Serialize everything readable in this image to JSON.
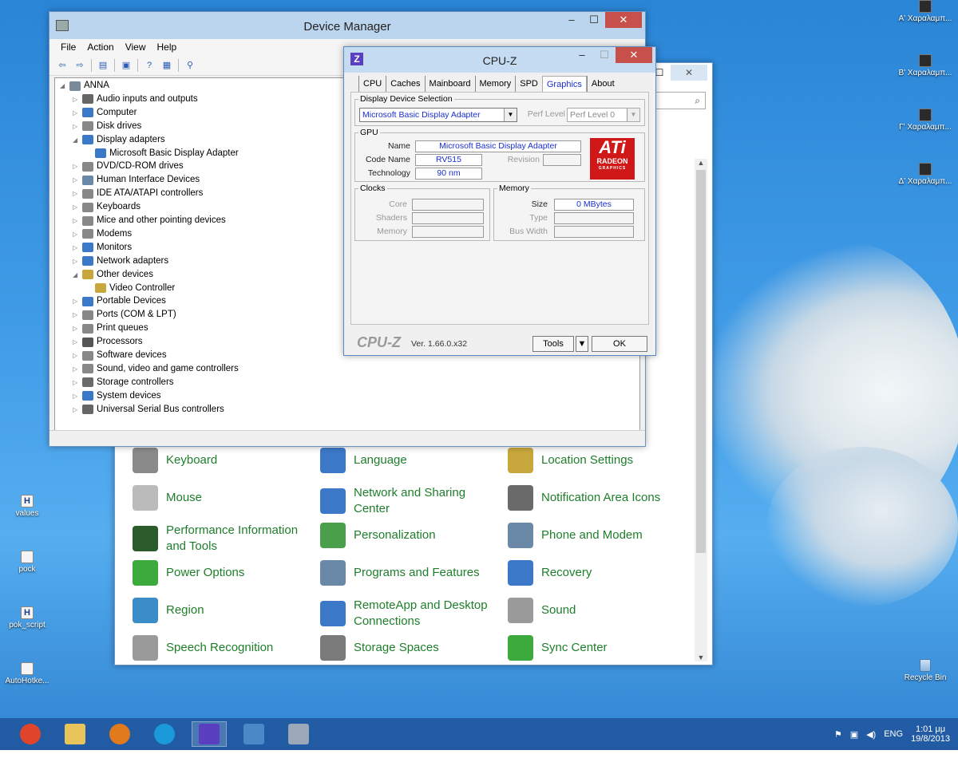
{
  "desktop": {
    "icons_right": [
      {
        "label": "Α' Χαραλαμπ..."
      },
      {
        "label": "Β' Χαραλαμπ..."
      },
      {
        "label": "Γ' Χαραλαμπ..."
      },
      {
        "label": "Δ' Χαραλαμπ..."
      }
    ],
    "icons_left": [
      {
        "label": "values"
      },
      {
        "label": "pock"
      },
      {
        "label": "pok_script"
      },
      {
        "label": "AutoHotke..."
      }
    ],
    "recycle_bin": "Recycle Bin"
  },
  "control_panel": {
    "search_glyph": "⌕",
    "items": [
      {
        "label": "Keyboard",
        "color": "#8a8a8a"
      },
      {
        "label": "Language",
        "color": "#3c78c8"
      },
      {
        "label": "Location Settings",
        "color": "#c8a83c"
      },
      {
        "label": "Mouse",
        "color": "#bbbbbb"
      },
      {
        "label": "Network and Sharing Center",
        "color": "#3c78c8"
      },
      {
        "label": "Notification Area Icons",
        "color": "#6a6a6a"
      },
      {
        "label": "Performance Information and Tools",
        "color": "#2b5a2b"
      },
      {
        "label": "Personalization",
        "color": "#4aa04a"
      },
      {
        "label": "Phone and Modem",
        "color": "#6a88a8"
      },
      {
        "label": "Power Options",
        "color": "#3caa3c"
      },
      {
        "label": "Programs and Features",
        "color": "#6a88a8"
      },
      {
        "label": "Recovery",
        "color": "#3c78c8"
      },
      {
        "label": "Region",
        "color": "#3c8cc8"
      },
      {
        "label": "RemoteApp and Desktop Connections",
        "color": "#3c78c8"
      },
      {
        "label": "Sound",
        "color": "#9a9a9a"
      },
      {
        "label": "Speech Recognition",
        "color": "#9a9a9a"
      },
      {
        "label": "Storage Spaces",
        "color": "#7a7a7a"
      },
      {
        "label": "Sync Center",
        "color": "#3caa3c"
      }
    ]
  },
  "device_manager": {
    "title": "Device Manager",
    "menu": [
      "File",
      "Action",
      "View",
      "Help"
    ],
    "tree": [
      {
        "label": "ANNA",
        "level": 0,
        "arrow": "◢",
        "color": "#7a8a9a"
      },
      {
        "label": "Audio inputs and outputs",
        "level": 1,
        "arrow": "▷",
        "color": "#666666"
      },
      {
        "label": "Computer",
        "level": 1,
        "arrow": "▷",
        "color": "#3c78c8"
      },
      {
        "label": "Disk drives",
        "level": 1,
        "arrow": "▷",
        "color": "#888888"
      },
      {
        "label": "Display adapters",
        "level": 1,
        "arrow": "◢",
        "color": "#3c78c8"
      },
      {
        "label": "Microsoft Basic Display Adapter",
        "level": 2,
        "arrow": "",
        "color": "#3c78c8"
      },
      {
        "label": "DVD/CD-ROM drives",
        "level": 1,
        "arrow": "▷",
        "color": "#888888"
      },
      {
        "label": "Human Interface Devices",
        "level": 1,
        "arrow": "▷",
        "color": "#6a88a8"
      },
      {
        "label": "IDE ATA/ATAPI controllers",
        "level": 1,
        "arrow": "▷",
        "color": "#888888"
      },
      {
        "label": "Keyboards",
        "level": 1,
        "arrow": "▷",
        "color": "#888888"
      },
      {
        "label": "Mice and other pointing devices",
        "level": 1,
        "arrow": "▷",
        "color": "#888888"
      },
      {
        "label": "Modems",
        "level": 1,
        "arrow": "▷",
        "color": "#888888"
      },
      {
        "label": "Monitors",
        "level": 1,
        "arrow": "▷",
        "color": "#3c78c8"
      },
      {
        "label": "Network adapters",
        "level": 1,
        "arrow": "▷",
        "color": "#3c78c8"
      },
      {
        "label": "Other devices",
        "level": 1,
        "arrow": "◢",
        "color": "#c8a83c"
      },
      {
        "label": "Video Controller",
        "level": 2,
        "arrow": "",
        "color": "#c8a83c"
      },
      {
        "label": "Portable Devices",
        "level": 1,
        "arrow": "▷",
        "color": "#3c78c8"
      },
      {
        "label": "Ports (COM & LPT)",
        "level": 1,
        "arrow": "▷",
        "color": "#888888"
      },
      {
        "label": "Print queues",
        "level": 1,
        "arrow": "▷",
        "color": "#888888"
      },
      {
        "label": "Processors",
        "level": 1,
        "arrow": "▷",
        "color": "#555555"
      },
      {
        "label": "Software devices",
        "level": 1,
        "arrow": "▷",
        "color": "#888888"
      },
      {
        "label": "Sound, video and game controllers",
        "level": 1,
        "arrow": "▷",
        "color": "#888888"
      },
      {
        "label": "Storage controllers",
        "level": 1,
        "arrow": "▷",
        "color": "#6a6a6a"
      },
      {
        "label": "System devices",
        "level": 1,
        "arrow": "▷",
        "color": "#3c78c8"
      },
      {
        "label": "Universal Serial Bus controllers",
        "level": 1,
        "arrow": "▷",
        "color": "#666666"
      }
    ]
  },
  "cpuz": {
    "title": "CPU-Z",
    "tabs": [
      "CPU",
      "Caches",
      "Mainboard",
      "Memory",
      "SPD",
      "Graphics",
      "About"
    ],
    "active_tab": "Graphics",
    "display_selection_legend": "Display Device Selection",
    "display_device": "Microsoft Basic Display Adapter",
    "perf_level_label": "Perf Level",
    "perf_level_value": "Perf Level 0",
    "gpu_legend": "GPU",
    "name_label": "Name",
    "name_value": "Microsoft Basic Display Adapter",
    "code_name_label": "Code Name",
    "code_name_value": "RV515",
    "revision_label": "Revision",
    "technology_label": "Technology",
    "technology_value": "90 nm",
    "clocks_legend": "Clocks",
    "core_label": "Core",
    "shaders_label": "Shaders",
    "memory_clock_label": "Memory",
    "memory_legend": "Memory",
    "size_label": "Size",
    "size_value": "0 MBytes",
    "type_label": "Type",
    "bus_width_label": "Bus Width",
    "logo_line1": "ATi",
    "logo_line2": "RADEON",
    "logo_line3": "GRAPHICS",
    "footer_brand": "CPU-Z",
    "version": "Ver. 1.66.0.x32",
    "tools_label": "Tools",
    "ok_label": "OK"
  },
  "taskbar": {
    "apps": [
      {
        "name": "chrome",
        "color": "#e0442a"
      },
      {
        "name": "file-explorer",
        "color": "#e8c45a"
      },
      {
        "name": "firefox",
        "color": "#e07a1a"
      },
      {
        "name": "skype",
        "color": "#1a9ad8"
      },
      {
        "name": "cpu-z",
        "color": "#5a3fc0"
      },
      {
        "name": "control-panel",
        "color": "#4a88c8"
      },
      {
        "name": "device-manager",
        "color": "#9aa8b8"
      }
    ],
    "lang": "ENG",
    "time": "1:01 μμ",
    "date": "19/8/2013"
  }
}
